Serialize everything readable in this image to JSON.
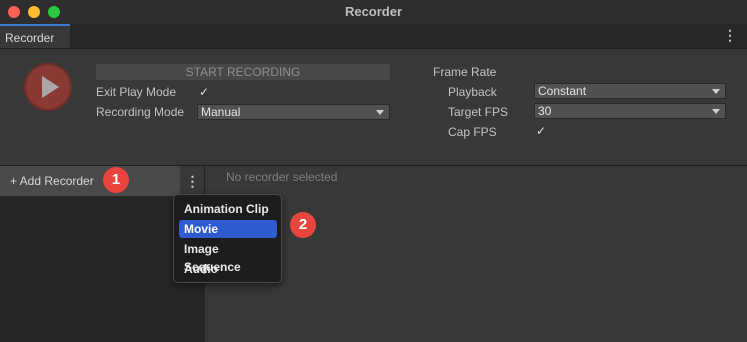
{
  "window": {
    "title": "Recorder"
  },
  "tab": {
    "label": "Recorder",
    "menu_glyph": "⋮"
  },
  "controls": {
    "start_recording": "START RECORDING",
    "exit_play_mode_label": "Exit Play Mode",
    "exit_play_mode_checked": "✓",
    "recording_mode_label": "Recording Mode",
    "recording_mode_value": "Manual"
  },
  "frame_rate": {
    "section_label": "Frame Rate",
    "playback_label": "Playback",
    "playback_value": "Constant",
    "target_fps_label": "Target FPS",
    "target_fps_value": "30",
    "cap_fps_label": "Cap FPS",
    "cap_fps_checked": "✓"
  },
  "recorder_list": {
    "add_label": "+ Add Recorder",
    "more_glyph": "⋮",
    "empty_message": "No recorder selected"
  },
  "add_menu": {
    "items": [
      "Animation Clip",
      "Movie",
      "Image Sequence",
      "Audio"
    ],
    "selected": "Movie"
  },
  "callouts": [
    "1",
    "2"
  ],
  "colors": {
    "accent": "#2f5bd1",
    "callout": "#e9453f",
    "record_button": "#8a3a34"
  }
}
